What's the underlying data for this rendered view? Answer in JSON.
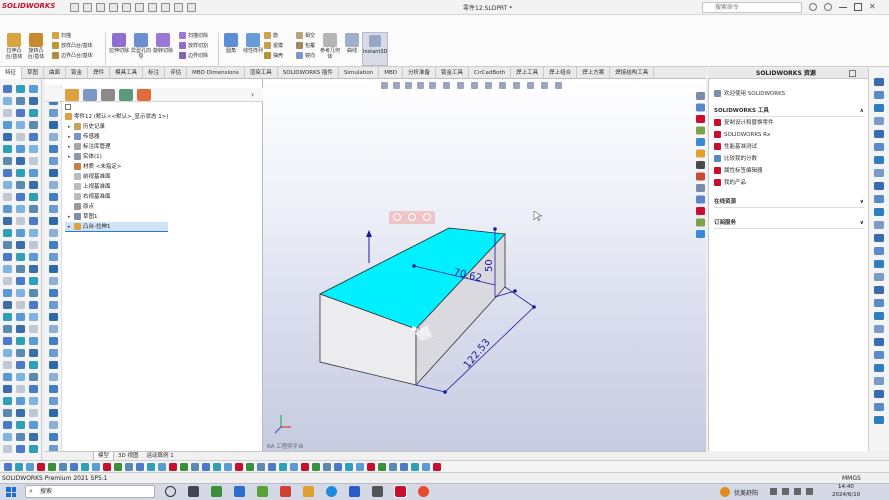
{
  "app": {
    "brand": "SOLIDWORKS",
    "doc_title": "零件12.SLDPRT *",
    "search_placeholder": "搜索命令"
  },
  "ribbon": {
    "big_buttons": [
      "拉伸凸台/基体",
      "旋转凸台/基体",
      "拉伸切除",
      "异型孔向导",
      "旋转切除",
      "圆角",
      "线性阵列",
      "筋",
      "参考几何体",
      "曲线",
      "Instant3D"
    ],
    "small_buttons": [
      "扫描",
      "放样凸台/基体",
      "边界凸台/基体",
      "扫描切除",
      "放样切割",
      "边界切除",
      "拔模",
      "抽壳",
      "相交",
      "包覆",
      "镜向"
    ]
  },
  "tabs": [
    "特征",
    "草图",
    "曲面",
    "钣金",
    "焊件",
    "模具工具",
    "标注",
    "评估",
    "MBD Dimensions",
    "渲染工具",
    "SOLIDWORKS 插件",
    "Simulation",
    "MBD",
    "分析准备",
    "钣金工具",
    "CirCadBoth",
    "焊上工具",
    "焊上组合",
    "焊上方案",
    "焊接结构工具"
  ],
  "feature_tree": {
    "root": "零件12 (默认<<默认>_显示状态 1>)",
    "items": [
      {
        "label": "历史记录",
        "expander": "▸"
      },
      {
        "label": "传感器",
        "expander": "▸"
      },
      {
        "label": "标注库管理",
        "expander": "▸"
      },
      {
        "label": "实体(1)",
        "expander": "▸"
      },
      {
        "label": "材质 <未指定>",
        "expander": ""
      },
      {
        "label": "前视基准面",
        "expander": ""
      },
      {
        "label": "上视基准面",
        "expander": ""
      },
      {
        "label": "右视基准面",
        "expander": ""
      },
      {
        "label": "原点",
        "expander": ""
      },
      {
        "label": "草图1",
        "expander": "▸"
      },
      {
        "label": "凸台-拉伸1",
        "expander": "▸"
      }
    ]
  },
  "viewport": {
    "dim_width": "70.62",
    "dim_height": "50",
    "dim_depth": "122.53",
    "brand_watermark": "RA 工程师平台"
  },
  "taskpane": {
    "header": "SOLIDWORKS 资源",
    "rows": [
      "欢迎使用 SOLIDWORKS"
    ],
    "sec_tools": "SOLIDWORKS 工具",
    "tool_rows": [
      "复制设计和替换零件",
      "SOLIDWORKS Rx",
      "性能基准测试",
      "比较我的分数",
      "属性标签编辑器",
      "我的产品"
    ],
    "sec_community": "在线资源",
    "sec_subscription": "订阅服务"
  },
  "bottom_tabs": [
    "模型",
    "3D 视图",
    "运动算例 1"
  ],
  "status": {
    "left": "SOLIDWORKS Premium 2021 SP5.1",
    "units": "MMGS",
    "time": "14:40",
    "date": "2024/6/10"
  },
  "taskbar": {
    "search_label": "搜索",
    "weather": "优美舒阳"
  },
  "colors": {
    "face_top": "#00f0ff",
    "face_front": "#ececef",
    "face_side": "#d9d9df",
    "dim_color": "#1a1aa0",
    "brand_red": "#c8102e"
  }
}
